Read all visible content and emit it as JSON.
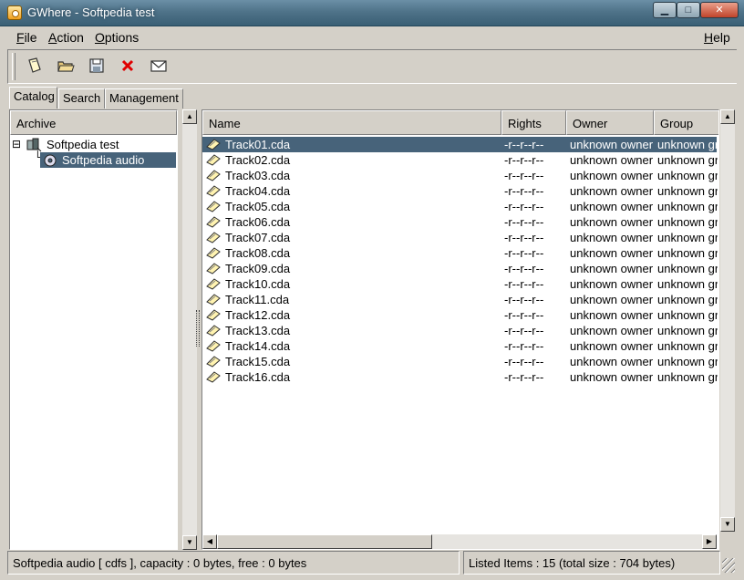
{
  "window": {
    "title": "GWhere - Softpedia test",
    "min_label": "▁",
    "max_label": "□",
    "close_label": "✕"
  },
  "menu": {
    "file": "ile",
    "file_mnemonic": "F",
    "action": "ction",
    "action_mnemonic": "A",
    "options": "ptions",
    "options_mnemonic": "O",
    "help": "elp",
    "help_mnemonic": "H"
  },
  "toolbar": [
    "new-catalog-icon",
    "open-folder-icon",
    "save-disk-icon",
    "delete-icon",
    "mail-icon"
  ],
  "tabs": [
    {
      "label": "Catalog",
      "active": true
    },
    {
      "label": "Search"
    },
    {
      "label": "Management"
    }
  ],
  "tree": {
    "header": "Archive",
    "items": [
      {
        "label": "Softpedia test",
        "expander": "⊟",
        "level": 0
      },
      {
        "label": "Softpedia audio",
        "level": 1,
        "selected": true
      }
    ]
  },
  "list": {
    "columns": [
      "Name",
      "Rights",
      "Owner",
      "Group"
    ],
    "rows": [
      {
        "name": "Track01.cda",
        "rights": "-r--r--r--",
        "owner": "unknown owner",
        "group": "unknown group"
      },
      {
        "name": "Track02.cda",
        "rights": "-r--r--r--",
        "owner": "unknown owner",
        "group": "unknown group"
      },
      {
        "name": "Track03.cda",
        "rights": "-r--r--r--",
        "owner": "unknown owner",
        "group": "unknown group"
      },
      {
        "name": "Track04.cda",
        "rights": "-r--r--r--",
        "owner": "unknown owner",
        "group": "unknown group"
      },
      {
        "name": "Track05.cda",
        "rights": "-r--r--r--",
        "owner": "unknown owner",
        "group": "unknown group"
      },
      {
        "name": "Track06.cda",
        "rights": "-r--r--r--",
        "owner": "unknown owner",
        "group": "unknown group"
      },
      {
        "name": "Track07.cda",
        "rights": "-r--r--r--",
        "owner": "unknown owner",
        "group": "unknown group"
      },
      {
        "name": "Track08.cda",
        "rights": "-r--r--r--",
        "owner": "unknown owner",
        "group": "unknown group"
      },
      {
        "name": "Track09.cda",
        "rights": "-r--r--r--",
        "owner": "unknown owner",
        "group": "unknown group"
      },
      {
        "name": "Track10.cda",
        "rights": "-r--r--r--",
        "owner": "unknown owner",
        "group": "unknown group"
      },
      {
        "name": "Track11.cda",
        "rights": "-r--r--r--",
        "owner": "unknown owner",
        "group": "unknown group"
      },
      {
        "name": "Track12.cda",
        "rights": "-r--r--r--",
        "owner": "unknown owner",
        "group": "unknown group"
      },
      {
        "name": "Track13.cda",
        "rights": "-r--r--r--",
        "owner": "unknown owner",
        "group": "unknown group"
      },
      {
        "name": "Track14.cda",
        "rights": "-r--r--r--",
        "owner": "unknown owner",
        "group": "unknown group"
      },
      {
        "name": "Track15.cda",
        "rights": "-r--r--r--",
        "owner": "unknown owner",
        "group": "unknown group"
      },
      {
        "name": "Track16.cda",
        "rights": "-r--r--r--",
        "owner": "unknown owner",
        "group": "unknown group"
      }
    ],
    "selected_index": 0
  },
  "status": {
    "left": "Softpedia audio [ cdfs ], capacity : 0 bytes, free : 0 bytes",
    "right": "Listed Items : 15 (total size : 704 bytes)"
  },
  "colors": {
    "selection": "#47637a",
    "face": "#d4d0c8"
  }
}
